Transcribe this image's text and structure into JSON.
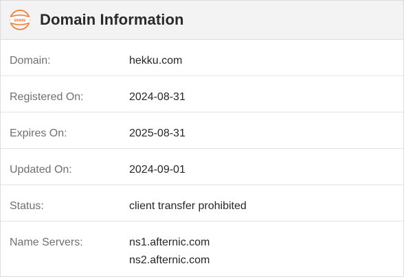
{
  "header": {
    "icon": "www-globe-icon",
    "icon_label": "www",
    "title": "Domain Information",
    "accent_color": "#f07c3a"
  },
  "rows": [
    {
      "label": "Domain:",
      "value": "hekku.com"
    },
    {
      "label": "Registered On:",
      "value": "2024-08-31"
    },
    {
      "label": "Expires On:",
      "value": "2025-08-31"
    },
    {
      "label": "Updated On:",
      "value": "2024-09-01"
    },
    {
      "label": "Status:",
      "value": "client transfer prohibited"
    }
  ],
  "name_servers": {
    "label": "Name Servers:",
    "values": [
      "ns1.afternic.com",
      "ns2.afternic.com"
    ]
  }
}
